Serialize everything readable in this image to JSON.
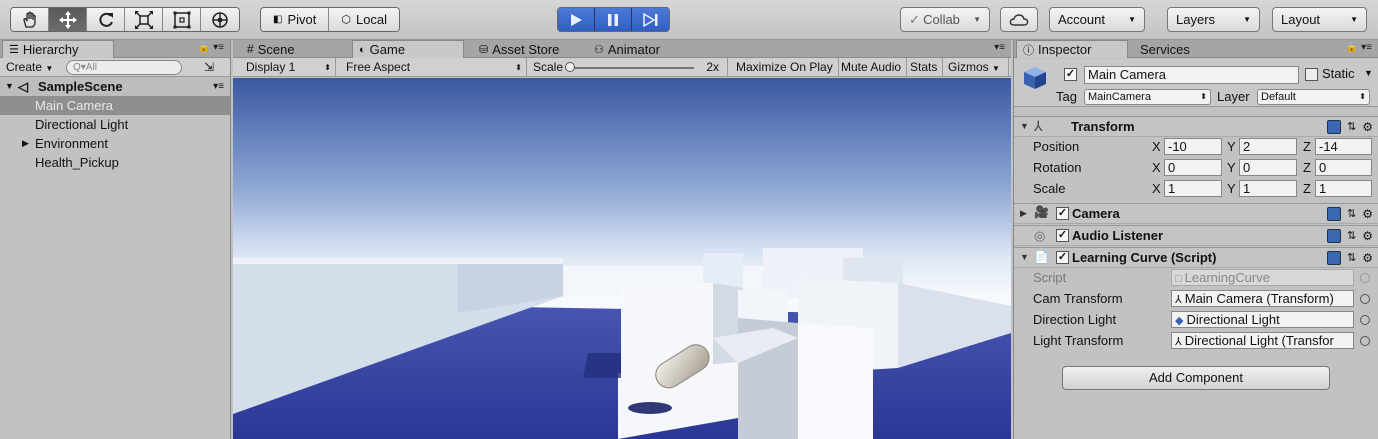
{
  "toolbar": {
    "tools": [
      "hand-tool-icon",
      "move-tool-icon",
      "rotate-tool-icon",
      "scale-tool-icon",
      "rect-tool-icon",
      "transform-tool-icon"
    ],
    "pivot_label": "Pivot",
    "local_label": "Local",
    "collab_label": "Collab",
    "account_label": "Account",
    "layers_label": "Layers",
    "layout_label": "Layout"
  },
  "hierarchy": {
    "tab_label": "Hierarchy",
    "create_label": "Create",
    "search_placeholder": "Q▾All",
    "scene_name": "SampleScene",
    "items": [
      {
        "label": "Main Camera",
        "selected": true,
        "expandable": false
      },
      {
        "label": "Directional Light",
        "selected": false,
        "expandable": false
      },
      {
        "label": "Environment",
        "selected": false,
        "expandable": true
      },
      {
        "label": "Health_Pickup",
        "selected": false,
        "expandable": false
      }
    ]
  },
  "center": {
    "tabs": [
      {
        "label": "Scene",
        "active": false
      },
      {
        "label": "Game",
        "active": true
      },
      {
        "label": "Asset Store",
        "active": false
      },
      {
        "label": "Animator",
        "active": false
      }
    ],
    "display": "Display 1",
    "aspect": "Free Aspect",
    "scale_label": "Scale",
    "scale_value": "2x",
    "maximize_label": "Maximize On Play",
    "mute_label": "Mute Audio",
    "stats_label": "Stats",
    "gizmos_label": "Gizmos"
  },
  "inspector": {
    "tabs": [
      {
        "label": "Inspector",
        "active": true
      },
      {
        "label": "Services",
        "active": false
      }
    ],
    "object_name": "Main Camera",
    "static_label": "Static",
    "tag_label": "Tag",
    "tag_value": "MainCamera",
    "layer_label": "Layer",
    "layer_value": "Default",
    "transform": {
      "title": "Transform",
      "rows": [
        {
          "label": "Position",
          "x": "-10",
          "y": "2",
          "z": "-14"
        },
        {
          "label": "Rotation",
          "x": "0",
          "y": "0",
          "z": "0"
        },
        {
          "label": "Scale",
          "x": "1",
          "y": "1",
          "z": "1"
        }
      ],
      "axis": [
        "X",
        "Y",
        "Z"
      ]
    },
    "camera_title": "Camera",
    "audio_title": "Audio Listener",
    "script_component": {
      "title": "Learning Curve (Script)",
      "fields": [
        {
          "label": "Script",
          "value": "LearningCurve",
          "disabled": true
        },
        {
          "label": "Cam Transform",
          "value": "Main Camera (Transform)",
          "disabled": false
        },
        {
          "label": "Direction Light",
          "value": "Directional Light",
          "disabled": false
        },
        {
          "label": "Light Transform",
          "value": "Directional Light (Transfor",
          "disabled": false
        }
      ]
    },
    "add_component_label": "Add Component"
  },
  "colors": {
    "accent_play": "#3a68c8",
    "selection": "#8e8e8e",
    "ground": "#2e3a96",
    "sky_top": "#3e5fa8"
  }
}
